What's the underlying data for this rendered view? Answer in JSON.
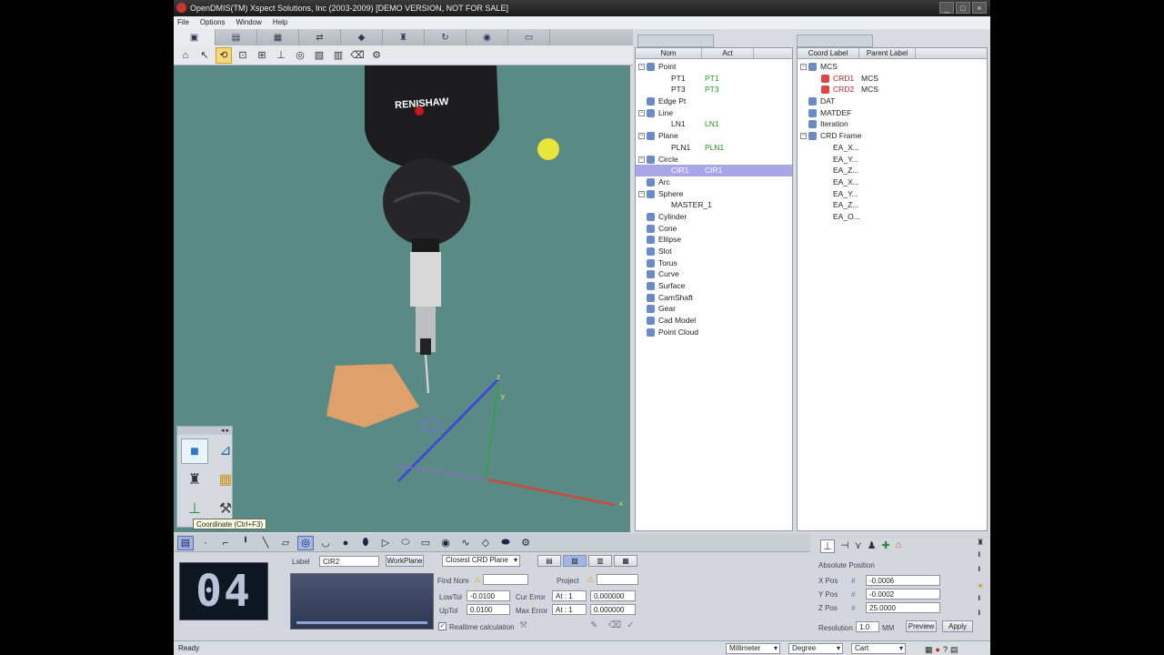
{
  "window": {
    "title": "OpenDMIS(TM)  Xspect Solutions, Inc  (2003-2009) [DEMO VERSION, NOT FOR SALE]",
    "buttons": [
      "_",
      "□",
      "×"
    ]
  },
  "menu": [
    "File",
    "Options",
    "Window",
    "Help"
  ],
  "viewport": {
    "probe_brand": "RENISHAW",
    "axes": {
      "x": "x",
      "y": "y",
      "z": "z"
    }
  },
  "features_panel": {
    "columns": [
      "Nom",
      "Act"
    ],
    "rows": [
      {
        "label": "Point",
        "act": "",
        "level": 0,
        "expanded": true
      },
      {
        "label": "PT1",
        "act": "PT1",
        "level": 1
      },
      {
        "label": "PT3",
        "act": "PT3",
        "level": 1
      },
      {
        "label": "Edge Pt",
        "act": "",
        "level": 0
      },
      {
        "label": "Line",
        "act": "",
        "level": 0,
        "expanded": true
      },
      {
        "label": "LN1",
        "act": "LN1",
        "level": 1
      },
      {
        "label": "Plane",
        "act": "",
        "level": 0,
        "expanded": true
      },
      {
        "label": "PLN1",
        "act": "PLN1",
        "level": 1
      },
      {
        "label": "Circle",
        "act": "",
        "level": 0,
        "expanded": true
      },
      {
        "label": "CIR1",
        "act": "CIR1",
        "level": 1,
        "selected": true
      },
      {
        "label": "Arc",
        "act": "",
        "level": 0
      },
      {
        "label": "Sphere",
        "act": "",
        "level": 0,
        "expanded": true
      },
      {
        "label": "MASTER_1",
        "act": "",
        "level": 1
      },
      {
        "label": "Cylinder",
        "act": "",
        "level": 0
      },
      {
        "label": "Cone",
        "act": "",
        "level": 0
      },
      {
        "label": "Ellipse",
        "act": "",
        "level": 0
      },
      {
        "label": "Slot",
        "act": "",
        "level": 0
      },
      {
        "label": "Torus",
        "act": "",
        "level": 0
      },
      {
        "label": "Curve",
        "act": "",
        "level": 0
      },
      {
        "label": "Surface",
        "act": "",
        "level": 0
      },
      {
        "label": "CamShaft",
        "act": "",
        "level": 0
      },
      {
        "label": "Gear",
        "act": "",
        "level": 0
      },
      {
        "label": "Cad Model",
        "act": "",
        "level": 0
      },
      {
        "label": "Point Cloud",
        "act": "",
        "level": 0
      }
    ]
  },
  "coord_panel": {
    "columns": [
      "Coord Label",
      "Parent Label"
    ],
    "rows": [
      {
        "label": "MCS",
        "parent": "",
        "level": 0,
        "expanded": true
      },
      {
        "label": "CRD1",
        "parent": "MCS",
        "level": 1,
        "red": true
      },
      {
        "label": "CRD2",
        "parent": "MCS",
        "level": 1,
        "red": true
      },
      {
        "label": "DAT",
        "parent": "",
        "level": 0
      },
      {
        "label": "MATDEF",
        "parent": "",
        "level": 0
      },
      {
        "label": "Iteration",
        "parent": "",
        "level": 0
      },
      {
        "label": "CRD Frame",
        "parent": "",
        "level": 0,
        "expanded": true
      },
      {
        "label": "EA_X...",
        "parent": "",
        "level": 1
      },
      {
        "label": "EA_Y...",
        "parent": "",
        "level": 1
      },
      {
        "label": "EA_Z...",
        "parent": "",
        "level": 1
      },
      {
        "label": "EA_X...",
        "parent": "",
        "level": 1
      },
      {
        "label": "EA_Y...",
        "parent": "",
        "level": 1
      },
      {
        "label": "EA_Z...",
        "parent": "",
        "level": 1
      },
      {
        "label": "EA_O...",
        "parent": "",
        "level": 1
      }
    ]
  },
  "tooltip": "Coordinate (Ctrl+F3)",
  "counter": "04",
  "form": {
    "label_label": "Label",
    "label_value": "CIR2",
    "workplane": "WorkPlane",
    "plane_select": "Closest CRD Plane",
    "find_nom": "Find Nom",
    "project": "Project",
    "lowtol_label": "LowTol",
    "lowtol": "-0.0100",
    "uptol_label": "UpTol",
    "uptol": "0.0100",
    "cur_error": "Cur Error",
    "max_error": "Max Error",
    "at1": "At : 1",
    "at2": "At : 1",
    "err1": "0.000000",
    "err2": "0.000000",
    "realtime": "Realtime calculation"
  },
  "position": {
    "title": "Absolute Position",
    "x_label": "X Pos",
    "x": "-0.0006",
    "y_label": "Y Pos",
    "y": "-0.0002",
    "z_label": "Z Pos",
    "z": "25.0000",
    "res_label": "Resolution",
    "res": "1.0",
    "unit": "MM",
    "preview": "Preview",
    "apply": "Apply"
  },
  "status": {
    "text": "Ready",
    "units": "Millimeter",
    "angle": "Degree",
    "coord": "Cart"
  },
  "colors": {
    "viewport": "#5a8a86",
    "selected": "#a9a6e8",
    "act_green": "#1a9a1a",
    "crd_red": "#cc2020"
  }
}
